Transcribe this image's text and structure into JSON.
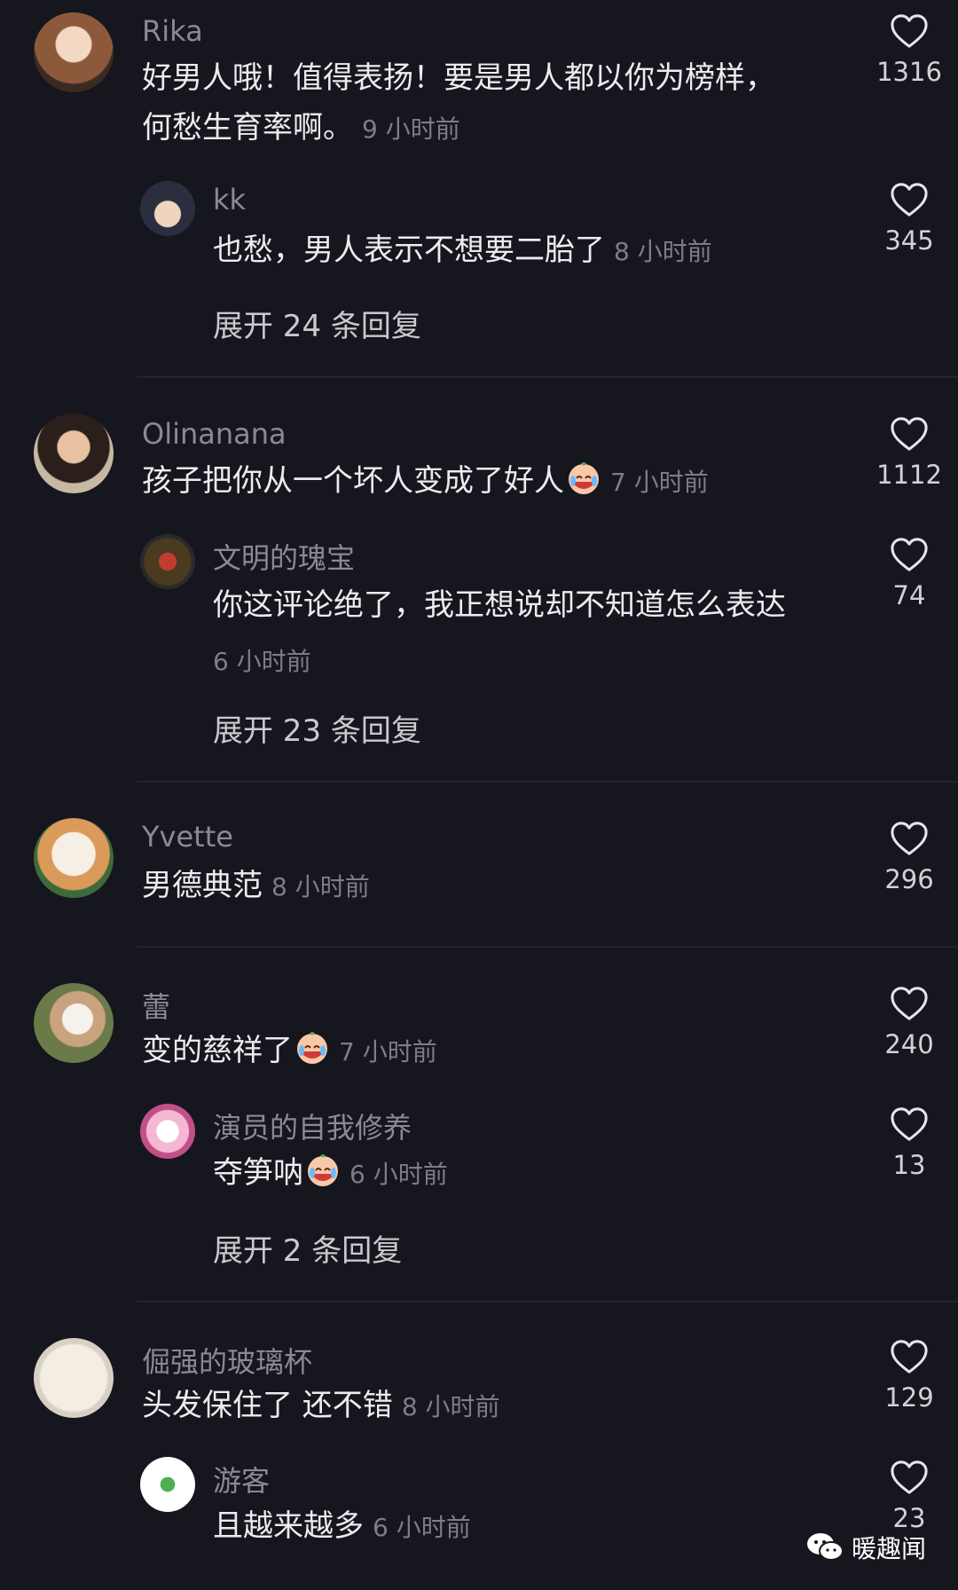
{
  "threads": [
    {
      "user": "Rika",
      "text_line1": "好男人哦！值得表扬！要是男人都以你为榜样，",
      "text_line2": "何愁生育率啊。",
      "time": "9 小时前",
      "likes": "1316",
      "reply": {
        "user": "kk",
        "text": "也愁，男人表示不想要二胎了",
        "time": "8 小时前",
        "likes": "345"
      },
      "expand": "展开 24 条回复"
    },
    {
      "user": "Olinanana",
      "text": "孩子把你从一个坏人变成了好人",
      "time": "7 小时前",
      "likes": "1112",
      "reply": {
        "user": "文明的瑰宝",
        "text": "你这评论绝了，我正想说却不知道怎么表达",
        "time": "6 小时前",
        "likes": "74"
      },
      "expand": "展开 23 条回复"
    },
    {
      "user": "Yvette",
      "text": "男德典范",
      "time": "8 小时前",
      "likes": "296"
    },
    {
      "user": "蕾",
      "text": "变的慈祥了",
      "time": "7 小时前",
      "likes": "240",
      "reply": {
        "user": "演员的自我修养",
        "text": "夺笋呐",
        "time": "6 小时前",
        "likes": "13"
      },
      "expand": "展开 2 条回复"
    },
    {
      "user": "倔强的玻璃杯",
      "text": "头发保住了 还不错",
      "time": "8 小时前",
      "likes": "129",
      "reply": {
        "user": "游客",
        "text": "且越来越多",
        "time": "6 小时前",
        "likes": "23"
      }
    }
  ],
  "watermark": "暖趣闻",
  "icons": {
    "like": "heart-outline-icon",
    "emoji": "crying-laughing-emoji-icon",
    "watermark": "wechat-icon"
  },
  "colors": {
    "background": "#16161e",
    "username": "#8a8a93",
    "text": "#ececef",
    "time": "#7d7d86"
  }
}
